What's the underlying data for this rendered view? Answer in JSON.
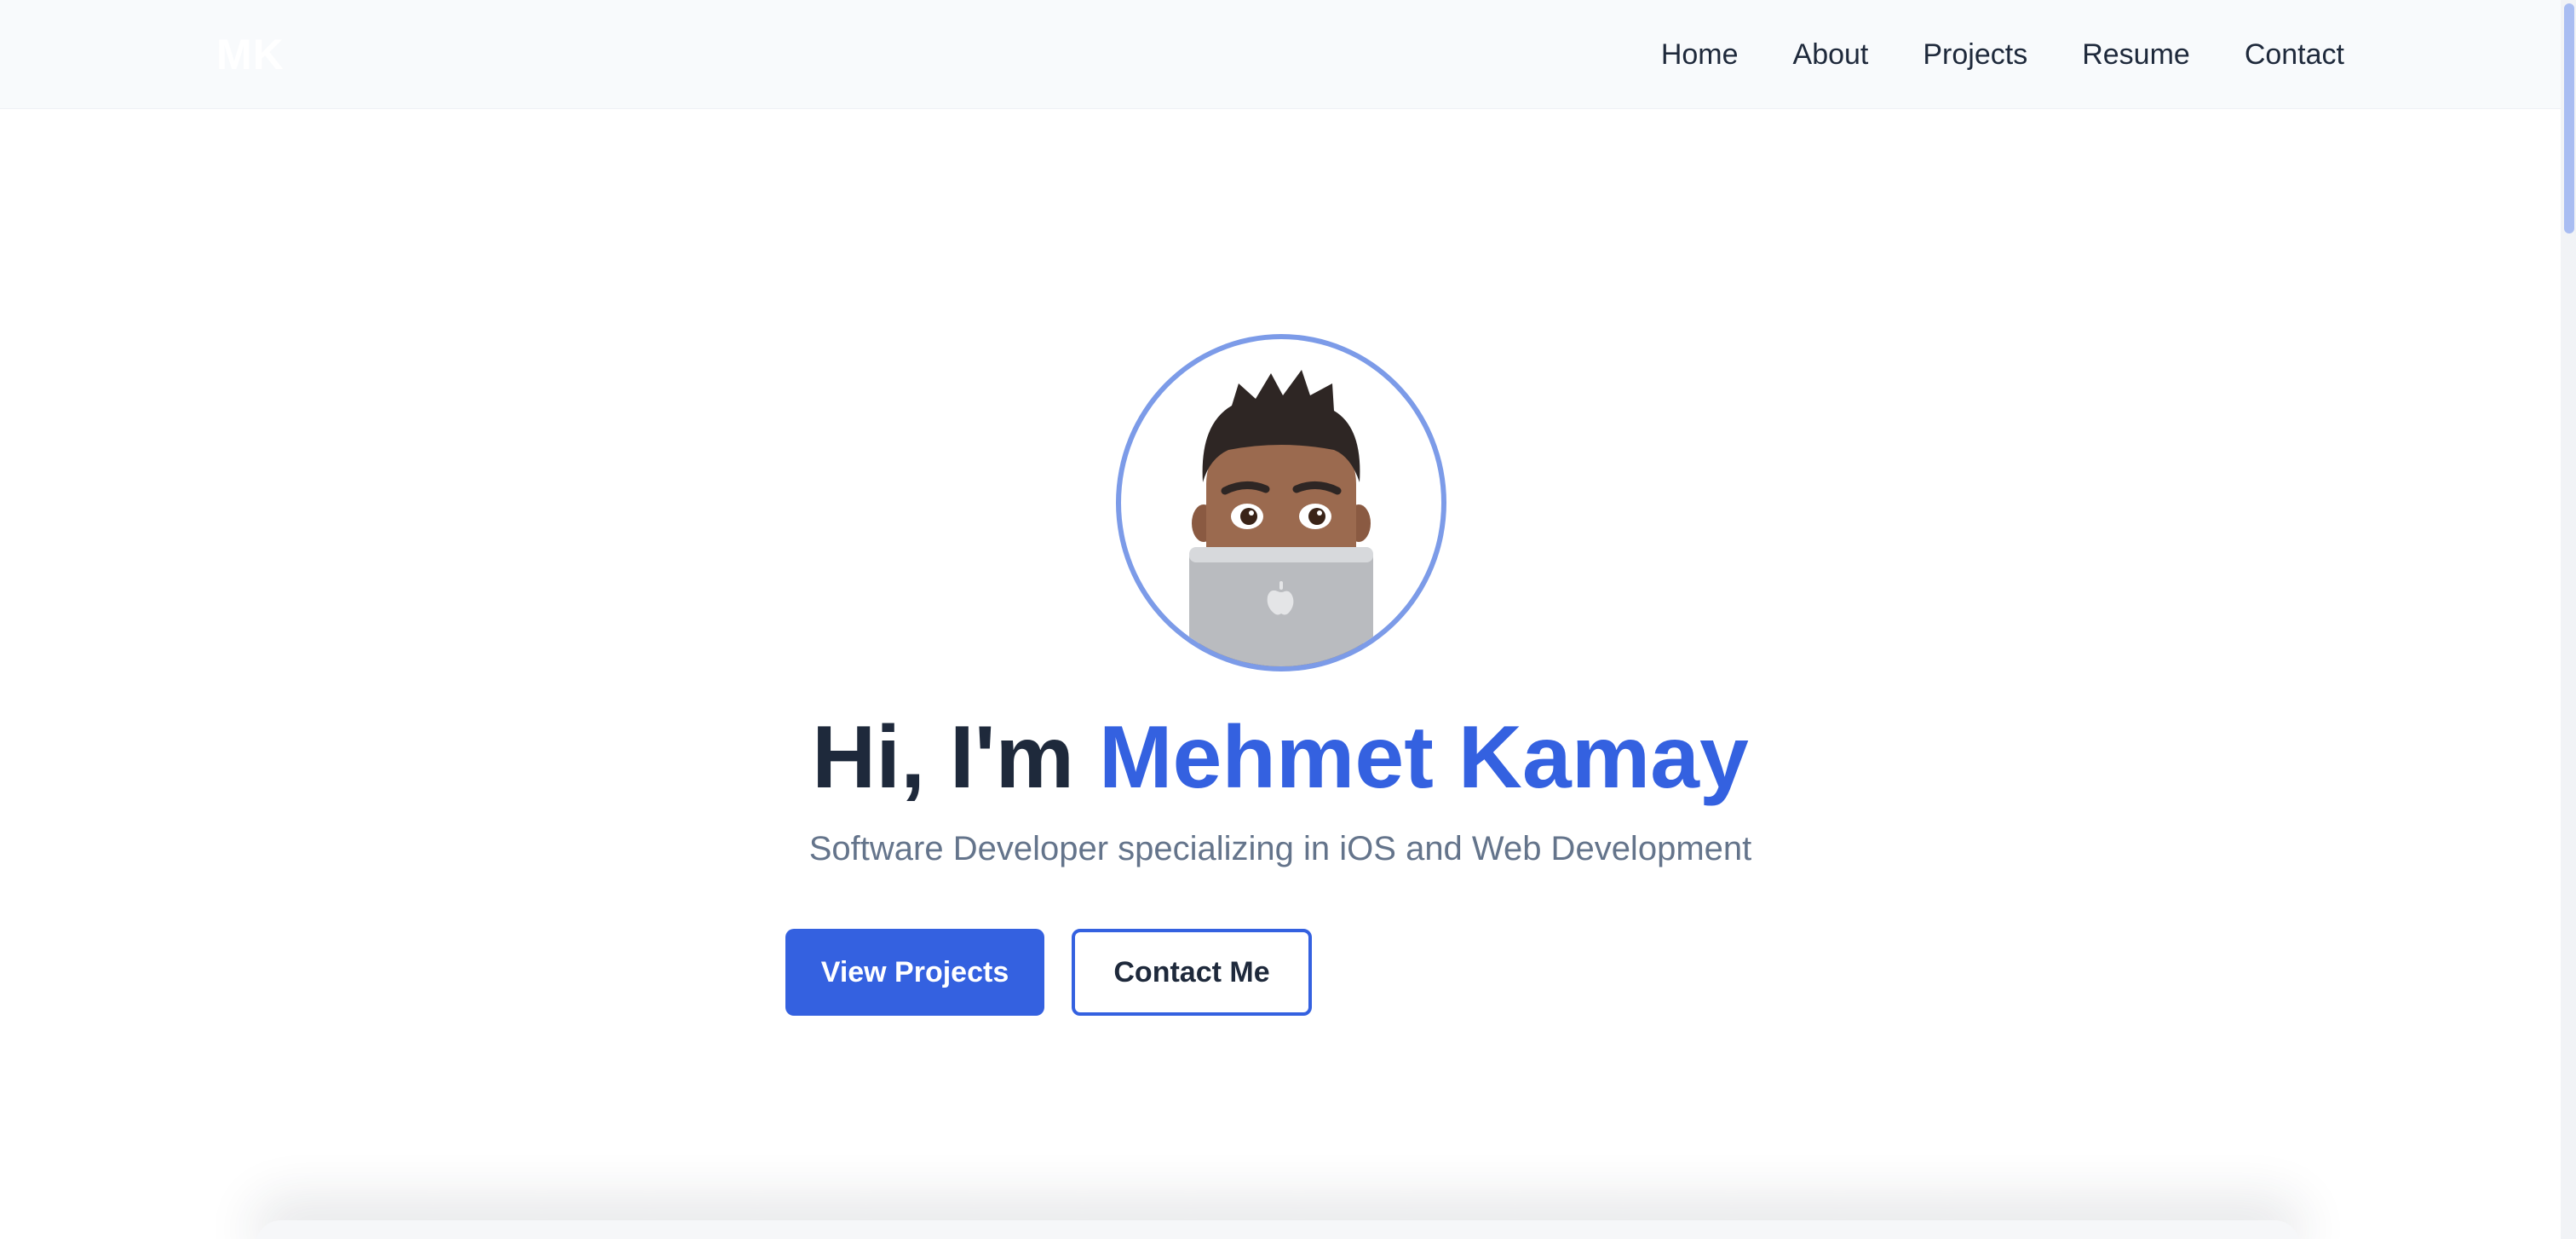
{
  "header": {
    "logo_text": "MK",
    "nav": [
      {
        "label": "Home"
      },
      {
        "label": "About"
      },
      {
        "label": "Projects"
      },
      {
        "label": "Resume"
      },
      {
        "label": "Contact"
      }
    ]
  },
  "hero": {
    "avatar_alt": "memoji-avatar-with-laptop",
    "greeting": "Hi, I'm ",
    "name": "Mehmet Kamay",
    "subtitle": "Software Developer specializing in iOS and Web Development",
    "primary_button": "View Projects",
    "secondary_button": "Contact Me"
  },
  "colors": {
    "accent": "#3461e0",
    "heading": "#1e293b",
    "muted": "#64748b",
    "nav_background": "#f8fafc",
    "avatar_ring": "#7c9be8"
  }
}
